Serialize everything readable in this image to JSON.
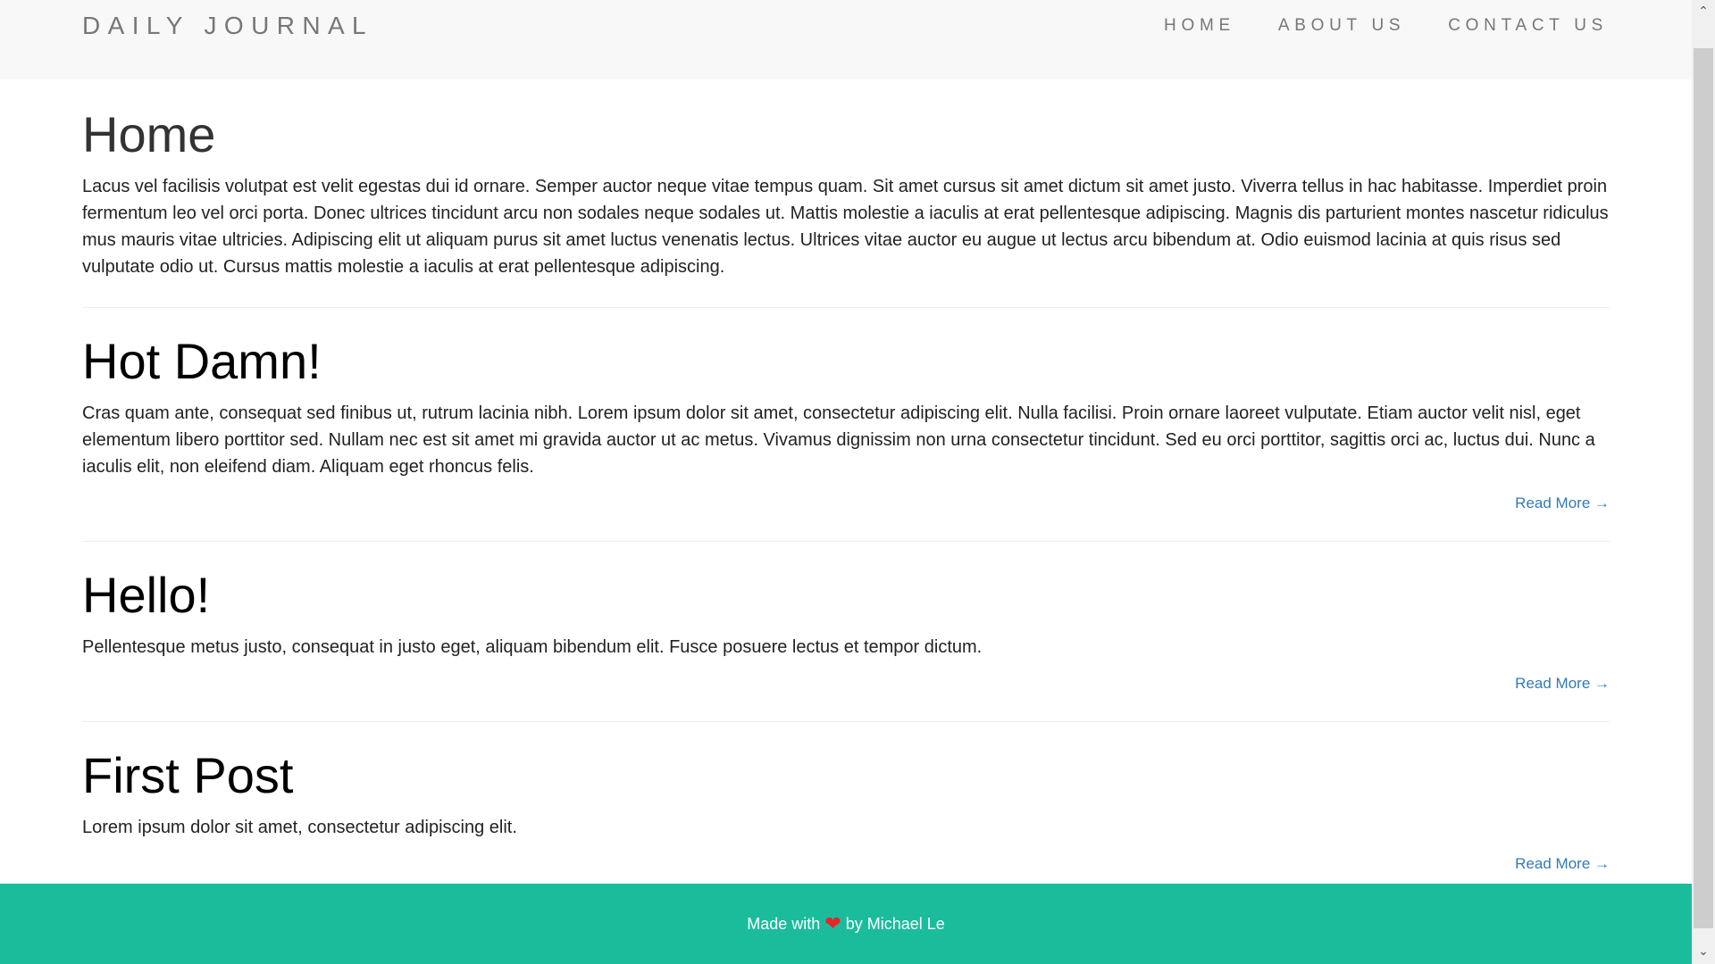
{
  "navbar": {
    "brand": "DAILY JOURNAL",
    "links": [
      "HOME",
      "ABOUT US",
      "CONTACT US"
    ]
  },
  "home": {
    "title": "Home",
    "text": "Lacus vel facilisis volutpat est velit egestas dui id ornare. Semper auctor neque vitae tempus quam. Sit amet cursus sit amet dictum sit amet justo. Viverra tellus in hac habitasse. Imperdiet proin fermentum leo vel orci porta. Donec ultrices tincidunt arcu non sodales neque sodales ut. Mattis molestie a iaculis at erat pellentesque adipiscing. Magnis dis parturient montes nascetur ridiculus mus mauris vitae ultricies. Adipiscing elit ut aliquam purus sit amet luctus venenatis lectus. Ultrices vitae auctor eu augue ut lectus arcu bibendum at. Odio euismod lacinia at quis risus sed vulputate odio ut. Cursus mattis molestie a iaculis at erat pellentesque adipiscing."
  },
  "posts": [
    {
      "title": "Hot Damn!",
      "text": "Cras quam ante, consequat sed finibus ut, rutrum lacinia nibh. Lorem ipsum dolor sit amet, consectetur adipiscing elit. Nulla facilisi. Proin ornare laoreet vulputate. Etiam auctor velit nisl, eget elementum libero porttitor sed. Nullam nec est sit amet mi gravida auctor ut ac metus. Vivamus dignissim non urna consectetur tincidunt. Sed eu orci porttitor, sagittis orci ac, luctus dui. Nunc a iaculis elit, non eleifend diam. Aliquam eget rhoncus felis.",
      "read_more": "Read More →"
    },
    {
      "title": "Hello!",
      "text": "Pellentesque metus justo, consequat in justo eget, aliquam bibendum elit. Fusce posuere lectus et tempor dictum.",
      "read_more": "Read More →"
    },
    {
      "title": "First Post",
      "text": "Lorem ipsum dolor sit amet, consectetur adipiscing elit.",
      "read_more": "Read More →"
    }
  ],
  "footer": {
    "prefix": "Made with",
    "icon": "heart-icon",
    "suffix": "by Michael Le"
  },
  "colors": {
    "footer": "#1abc9c",
    "link": "#337ab7",
    "navbar": "#f8f8f8",
    "heart": "#e8232a"
  }
}
